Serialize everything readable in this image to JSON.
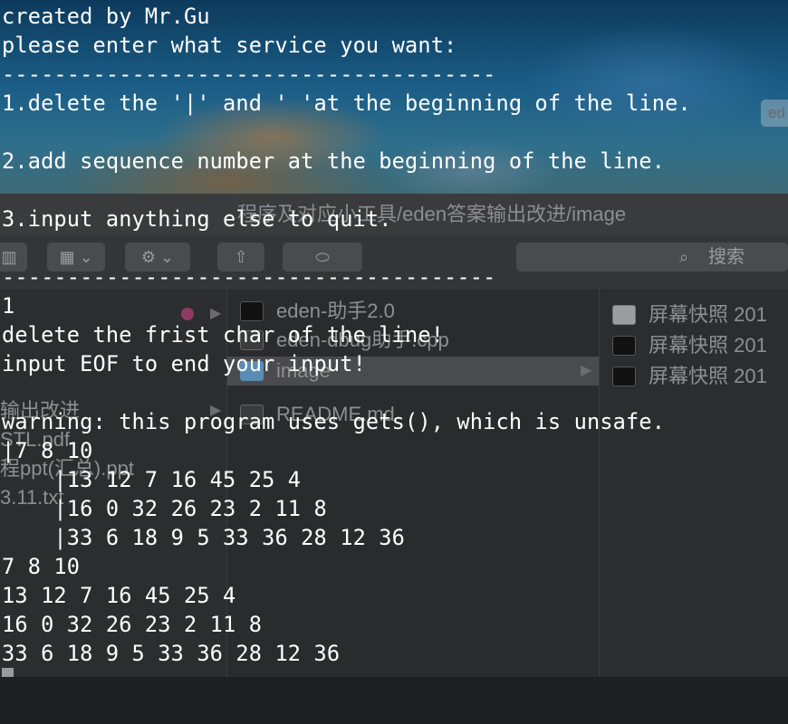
{
  "wallpaper": {
    "chip_text": "ed"
  },
  "finder": {
    "title": "程序及对应小工具/eden答案输出改进/image",
    "search_label": "搜索",
    "toolbar_icons": [
      "view-columns-icon",
      "gear-icon",
      "share-icon",
      "tag-icon"
    ],
    "left_items": [
      "输出改进",
      "STL.pdf",
      "程ppt(汇总).ppt",
      "3.11.txt"
    ],
    "middle_items": [
      {
        "name": "eden-助手2.0",
        "icon": "executable"
      },
      {
        "name": "eden-dbug助手.cpp",
        "icon": "document"
      },
      {
        "name": "image",
        "icon": "folder",
        "selected": true
      },
      {
        "name": "README.md",
        "icon": "document"
      }
    ],
    "right_items": [
      "屏幕快照 201",
      "屏幕快照 201",
      "屏幕快照 201"
    ]
  },
  "terminal": {
    "lines": [
      "created by Mr.Gu",
      "please enter what service you want:",
      "--------------------------------------",
      "1.delete the '|' and ' 'at the beginning of the line.",
      "",
      "2.add sequence number at the beginning of the line.",
      "",
      "3.input anything else to quit.",
      "",
      "--------------------------------------",
      "1",
      "delete the frist char of the line!",
      "input EOF to end your input!",
      "",
      "warning: this program uses gets(), which is unsafe.",
      "|7 8 10",
      "    |13 12 7 16 45 25 4",
      "    |16 0 32 26 23 2 11 8",
      "    |33 6 18 9 5 33 36 28 12 36",
      "7 8 10",
      "13 12 7 16 45 25 4",
      "16 0 32 26 23 2 11 8",
      "33 6 18 9 5 33 36 28 12 36"
    ]
  }
}
